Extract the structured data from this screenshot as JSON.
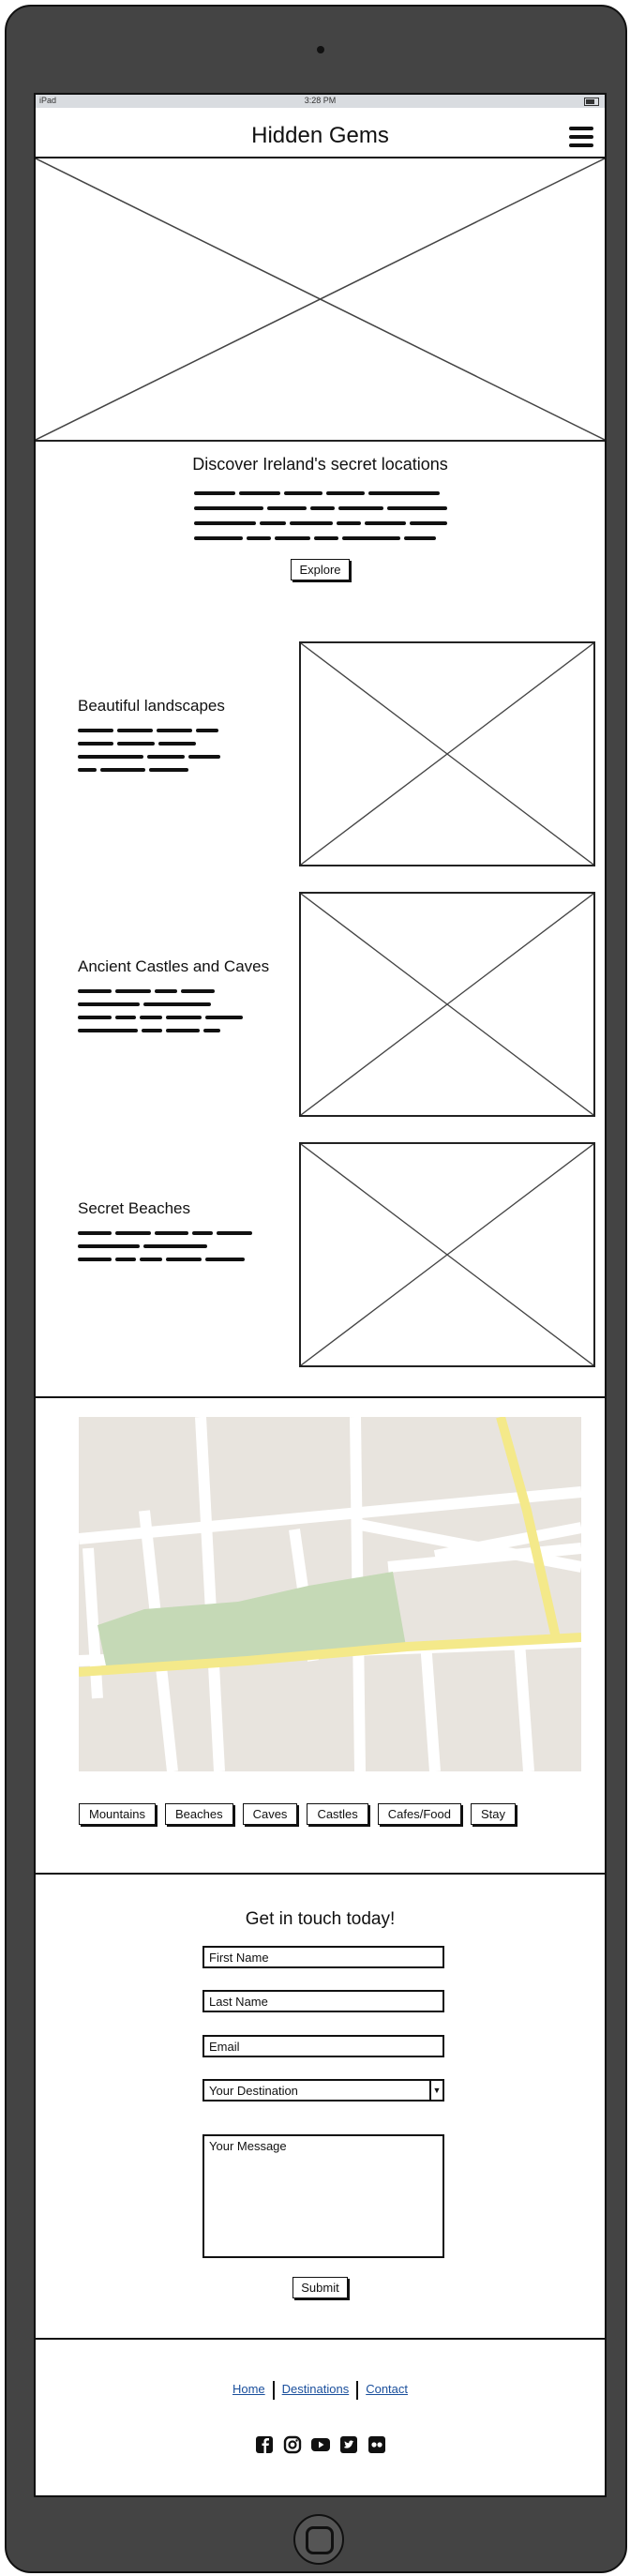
{
  "status_bar": {
    "device": "iPad",
    "time": "3:28 PM"
  },
  "header": {
    "title": "Hidden Gems",
    "menu_icon": "hamburger-icon"
  },
  "intro": {
    "title": "Discover Ireland's secret locations",
    "button": "Explore"
  },
  "features": [
    {
      "title": "Beautiful landscapes"
    },
    {
      "title": "Ancient Castles and Caves"
    },
    {
      "title": "Secret Beaches"
    }
  ],
  "map": {
    "filters": [
      "Mountains",
      "Beaches",
      "Caves",
      "Castles",
      "Cafes/Food",
      "Stay"
    ]
  },
  "contact": {
    "title": "Get in touch today!",
    "first_name": "First Name",
    "last_name": "Last Name",
    "email": "Email",
    "destination": "Your Destination",
    "message": "Your Message",
    "submit": "Submit"
  },
  "footer": {
    "links": [
      "Home",
      "Destinations",
      "Contact"
    ],
    "social_icons": [
      "facebook-icon",
      "instagram-icon",
      "youtube-icon",
      "twitter-icon",
      "flickr-icon"
    ]
  }
}
